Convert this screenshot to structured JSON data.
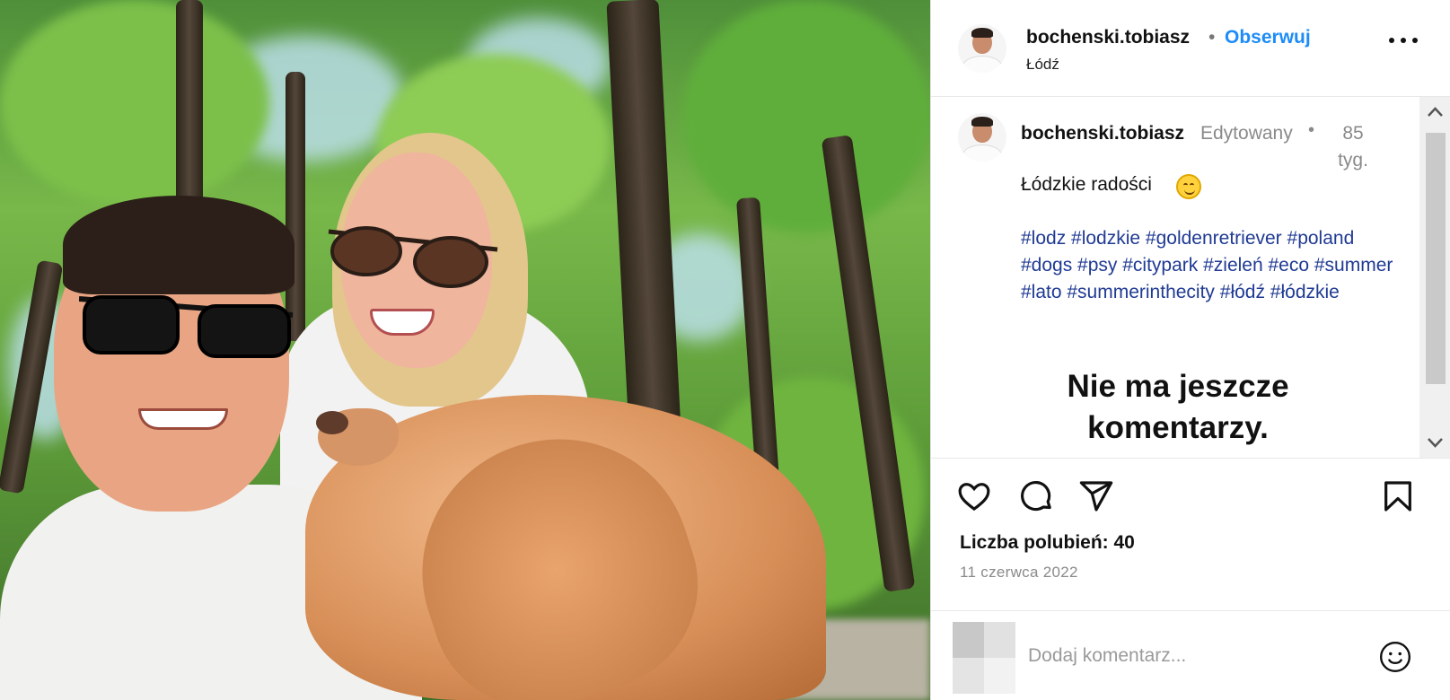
{
  "post": {
    "username": "bochenski.tobiasz",
    "separator": "•",
    "follow_label": "Obserwuj",
    "location": "Łódź"
  },
  "caption": {
    "username": "bochenski.tobiasz",
    "edited": "Edytowany",
    "dot": "•",
    "time_ago": "85 tyg.",
    "text": "Łódzkie radości",
    "emoji": "smiling-face-emoji",
    "hashtags": "#lodz #lodzkie #goldenretriever #poland #dogs #psy #citypark #zieleń #eco #summer #lato #summerinthecity #łódź #łódzkie"
  },
  "empty_comments": "Nie ma jeszcze komentarzy.",
  "actions": {
    "icons": [
      "heart-icon",
      "comment-icon",
      "share-icon",
      "bookmark-icon"
    ]
  },
  "likes_text": "Liczba polubień: 40",
  "date_text": "11 czerwca 2022",
  "add_comment": {
    "placeholder": "Dodaj komentarz..."
  },
  "colors": {
    "follow": "#1d8cf8",
    "hashtag": "#1f3a93",
    "muted": "#8a8a8a"
  }
}
